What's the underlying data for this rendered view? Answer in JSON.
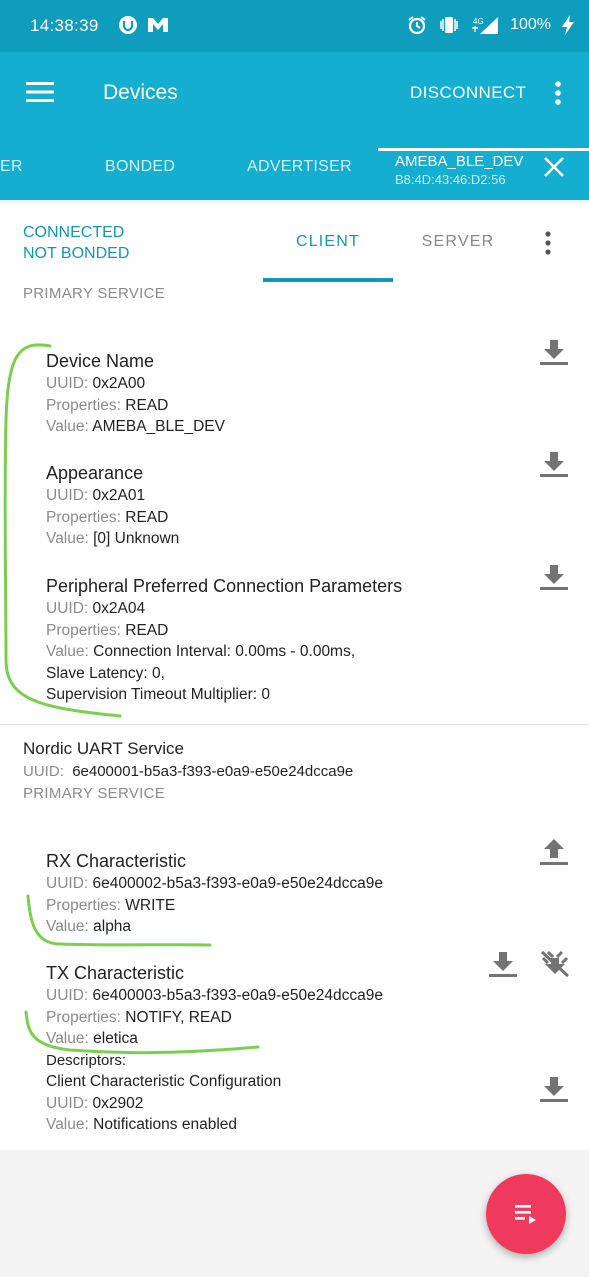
{
  "status_bar": {
    "time": "14:38:39",
    "battery": "100%",
    "network": "4G"
  },
  "app_bar": {
    "title": "Devices",
    "disconnect_label": "DISCONNECT"
  },
  "device_tabs": {
    "partial_tab": "ER",
    "bonded": "BONDED",
    "advertiser": "ADVERTISER",
    "active_name": "AMEBA_BLE_DEV",
    "active_address": "B8:4D:43:46:D2:56"
  },
  "connection": {
    "state": "CONNECTED",
    "bond_state": "NOT BONDED"
  },
  "sub_tabs": {
    "client": "CLIENT",
    "server": "SERVER"
  },
  "generic_access": {
    "type": "PRIMARY SERVICE",
    "characteristics": [
      {
        "title": "Device Name",
        "uuid_label": "UUID:",
        "uuid": "0x2A00",
        "props_label": "Properties:",
        "props": "READ",
        "value_label": "Value:",
        "value": "AMEBA_BLE_DEV"
      },
      {
        "title": "Appearance",
        "uuid_label": "UUID:",
        "uuid": "0x2A01",
        "props_label": "Properties:",
        "props": "READ",
        "value_label": "Value:",
        "value": "[0] Unknown"
      },
      {
        "title": "Peripheral Preferred Connection Parameters",
        "uuid_label": "UUID:",
        "uuid": "0x2A04",
        "props_label": "Properties:",
        "props": "READ",
        "value_label": "Value:",
        "value": "Connection Interval: 0.00ms - 0.00ms,",
        "value_line2": "Slave Latency: 0,",
        "value_line3": "Supervision Timeout Multiplier: 0"
      }
    ]
  },
  "uart_service": {
    "name": "Nordic UART Service",
    "uuid_label": "UUID:",
    "uuid": "6e400001-b5a3-f393-e0a9-e50e24dcca9e",
    "type": "PRIMARY SERVICE",
    "characteristics": [
      {
        "title": "RX Characteristic",
        "uuid_label": "UUID:",
        "uuid": "6e400002-b5a3-f393-e0a9-e50e24dcca9e",
        "props_label": "Properties:",
        "props": "WRITE",
        "value_label": "Value:",
        "value": "alpha"
      },
      {
        "title": "TX Characteristic",
        "uuid_label": "UUID:",
        "uuid": "6e400003-b5a3-f393-e0a9-e50e24dcca9e",
        "props_label": "Properties:",
        "props": "NOTIFY, READ",
        "value_label": "Value:",
        "value": "eletica"
      }
    ],
    "descriptor": {
      "heading": "Descriptors:",
      "title": "Client Characteristic Configuration",
      "uuid_label": "UUID:",
      "uuid": "0x2902",
      "value_label": "Value:",
      "value": "Notifications enabled"
    }
  },
  "colors": {
    "status_bar": "#0f9dbd",
    "app_bar": "#13aed0",
    "accent": "#1097b8",
    "fab": "#ef3a5d",
    "annotation": "#7ccf4e"
  },
  "icons": {
    "menu": "menu-icon",
    "overflow": "more-vert-icon",
    "close": "close-icon",
    "read": "download-icon",
    "write": "upload-icon",
    "notify_toggle": "notifications-off-icon",
    "fab": "log-list-icon"
  }
}
